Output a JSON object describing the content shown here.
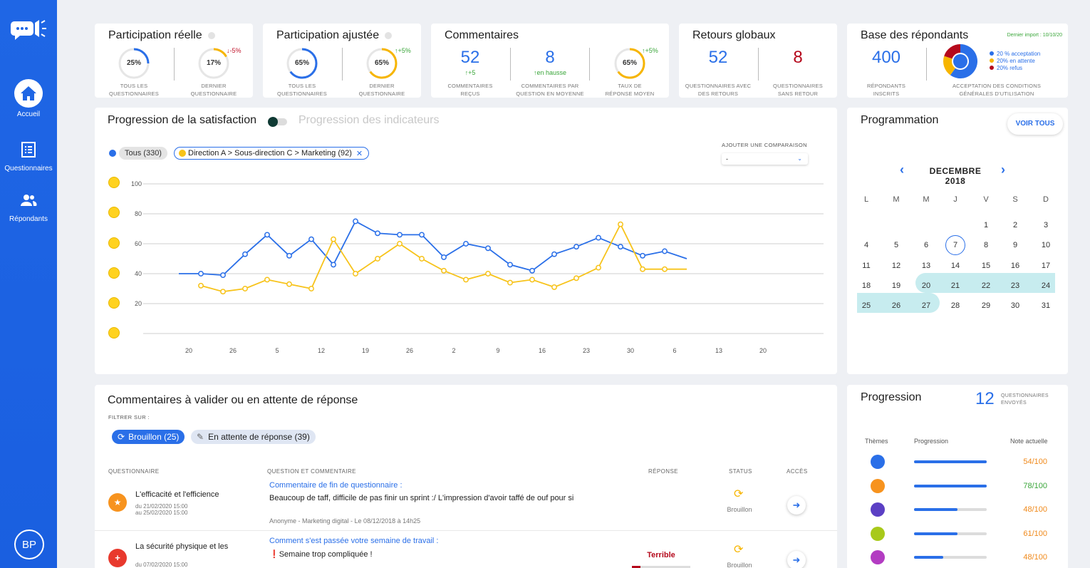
{
  "nav": {
    "items": [
      {
        "label": "Accueil"
      },
      {
        "label": "Questionnaires"
      },
      {
        "label": "Répondants"
      }
    ],
    "avatar": "BP"
  },
  "kpis": {
    "participation_reelle": {
      "title": "Participation réelle",
      "g1": {
        "value": "25%",
        "fraction": 0.25,
        "label1": "TOUS LES",
        "label2": "QUESTIONNAIRES"
      },
      "g2": {
        "value": "17%",
        "fraction": 0.17,
        "label1": "DERNIER",
        "label2": "QUESTIONNAIRE",
        "delta": "-5%"
      }
    },
    "participation_ajustee": {
      "title": "Participation ajustée",
      "g1": {
        "value": "65%",
        "fraction": 0.65,
        "label1": "TOUS LES",
        "label2": "QUESTIONNAIRES"
      },
      "g2": {
        "value": "65%",
        "fraction": 0.65,
        "label1": "DERNIER",
        "label2": "QUESTIONNAIRE",
        "delta": "+5%"
      }
    },
    "commentaires": {
      "title": "Commentaires",
      "n1": "52",
      "d1": "+5",
      "l1a": "COMMENTAIRES",
      "l1b": "REÇUS",
      "n2": "8",
      "d2": "en hausse",
      "l2a": "COMMENTAIRES PAR",
      "l2b": "QUESTION EN MOYENNE",
      "g": {
        "value": "65%",
        "fraction": 0.65,
        "delta": "+5%",
        "label1": "TAUX DE",
        "label2": "RÉPONSE MOYEN"
      }
    },
    "retours": {
      "title": "Retours globaux",
      "n1": "52",
      "l1a": "QUESTIONNAIRES AVEC",
      "l1b": "DES RETOURS",
      "n2": "8",
      "l2a": "QUESTIONNAIRES",
      "l2b": "SANS RETOUR"
    },
    "base": {
      "title": "Base des répondants",
      "import": "Dernier import : 10/10/20",
      "n": "400",
      "la": "RÉPONDANTS",
      "lb": "INSCRITS",
      "pie_label_a": "ACCEPTATION DES CONDITIONS",
      "pie_label_b": "GÉNÉRALES D'UTILISATION",
      "legend": [
        {
          "label": "20 % acceptation",
          "color": "#2a6fe8"
        },
        {
          "label": "20% en attente",
          "color": "#f7b500"
        },
        {
          "label": "20% refus",
          "color": "#b5091c"
        }
      ],
      "pie": [
        0.6,
        0.2,
        0.2
      ]
    }
  },
  "satisfaction": {
    "tab_active": "Progression de la satisfaction",
    "tab_inactive": "Progression des indicateurs",
    "chip_all": "Tous (330)",
    "chip_filter": "Direction A > Sous-direction C > Marketing (92)",
    "compare_label": "AJOUTER UNE COMPARAISON",
    "compare_value": "-"
  },
  "chart_data": {
    "type": "line",
    "categories": [
      "20",
      "",
      "26",
      "",
      "5",
      "",
      "12",
      "",
      "19",
      "",
      "26",
      "",
      "2",
      "",
      "9",
      "",
      "16",
      "",
      "23",
      "",
      "30",
      "",
      "6",
      "",
      "13",
      "",
      "20",
      ""
    ],
    "ylim": [
      0,
      100
    ],
    "yticks": [
      "100",
      "80",
      "60",
      "40",
      "20"
    ],
    "series": [
      {
        "name": "Tous (330)",
        "color": "#2a6fe8",
        "values": [
          40,
          40,
          39,
          53,
          66,
          52,
          63,
          46,
          75,
          67,
          66,
          66,
          51,
          60,
          57,
          46,
          42,
          53,
          58,
          64,
          58,
          52,
          55,
          50
        ]
      },
      {
        "name": "Direction A > Sous-direction C > Marketing (92)",
        "color": "#f7c31a",
        "values": [
          null,
          32,
          28,
          30,
          36,
          33,
          30,
          63,
          40,
          50,
          60,
          50,
          42,
          36,
          40,
          34,
          36,
          31,
          37,
          44,
          73,
          43,
          43,
          43
        ]
      }
    ]
  },
  "programmation": {
    "title": "Programmation",
    "voir_tous": "VOIR TOUS",
    "month": "DECEMBRE 2018",
    "weekdays": [
      "L",
      "M",
      "M",
      "J",
      "V",
      "S",
      "D"
    ],
    "weeks": [
      [
        "",
        "",
        "",
        "",
        "1",
        "2",
        "3"
      ],
      [
        "4",
        "5",
        "6",
        "7",
        "8",
        "9",
        "10"
      ],
      [
        "11",
        "12",
        "13",
        "14",
        "15",
        "16",
        "17"
      ],
      [
        "18",
        "19",
        "20",
        "21",
        "22",
        "23",
        "24"
      ],
      [
        "25",
        "26",
        "27",
        "28",
        "29",
        "30",
        "31"
      ]
    ],
    "today": "7"
  },
  "commentaires_valider": {
    "title": "Commentaires à valider ou en attente de réponse",
    "filter_label": "FILTRER SUR :",
    "chip_brouillon": "Brouillon (25)",
    "chip_attente": "En attente de réponse (39)",
    "headers": {
      "q": "QUESTIONNAIRE",
      "qc": "QUESTION ET COMMENTAIRE",
      "rep": "RÉPONSE",
      "status": "STATUS",
      "acces": "ACCÈS"
    },
    "rows": [
      {
        "name": "L'efficacité et l'efficience",
        "date1": "du 21/02/2020 15:00",
        "date2": "au 25/02/2020 15:00",
        "question": "Commentaire de fin de questionnaire :",
        "comment": "Beaucoup de taff, difficile de pas finir un sprint :/ L'impression d'avoir taffé de ouf pour si",
        "meta": "Anonyme - Marketing digital - Le 08/12/2018 à 14h25",
        "reponse": "",
        "status": "Brouillon"
      },
      {
        "name": "La sécurité physique et les",
        "date1": "du 07/02/2020 15:00",
        "question": "Comment s'est passée votre semaine de travail :",
        "comment": "Semaine trop compliquée !",
        "reponse": "Terrible",
        "status": "Brouillon"
      }
    ]
  },
  "progression": {
    "title": "Progression",
    "count": "12",
    "count_l1": "QUESTIONNAIRES",
    "count_l2": "ENVOYÉS",
    "h_themes": "Thèmes",
    "h_prog": "Progression",
    "h_note": "Note actuelle",
    "rows": [
      {
        "score": "54/100",
        "fill": 1.0,
        "color": "#2a6fe8",
        "score_color": "#f0891a"
      },
      {
        "score": "78/100",
        "fill": 1.0,
        "color": "#f7931e",
        "score_color": "#3aa63a"
      },
      {
        "score": "48/100",
        "fill": 0.6,
        "color": "#5b3fc4",
        "score_color": "#f0891a"
      },
      {
        "score": "61/100",
        "fill": 0.6,
        "color": "#a8c91a",
        "score_color": "#f0891a"
      },
      {
        "score": "48/100",
        "fill": 0.4,
        "color": "#b33cc2",
        "score_color": "#f0891a"
      }
    ]
  }
}
